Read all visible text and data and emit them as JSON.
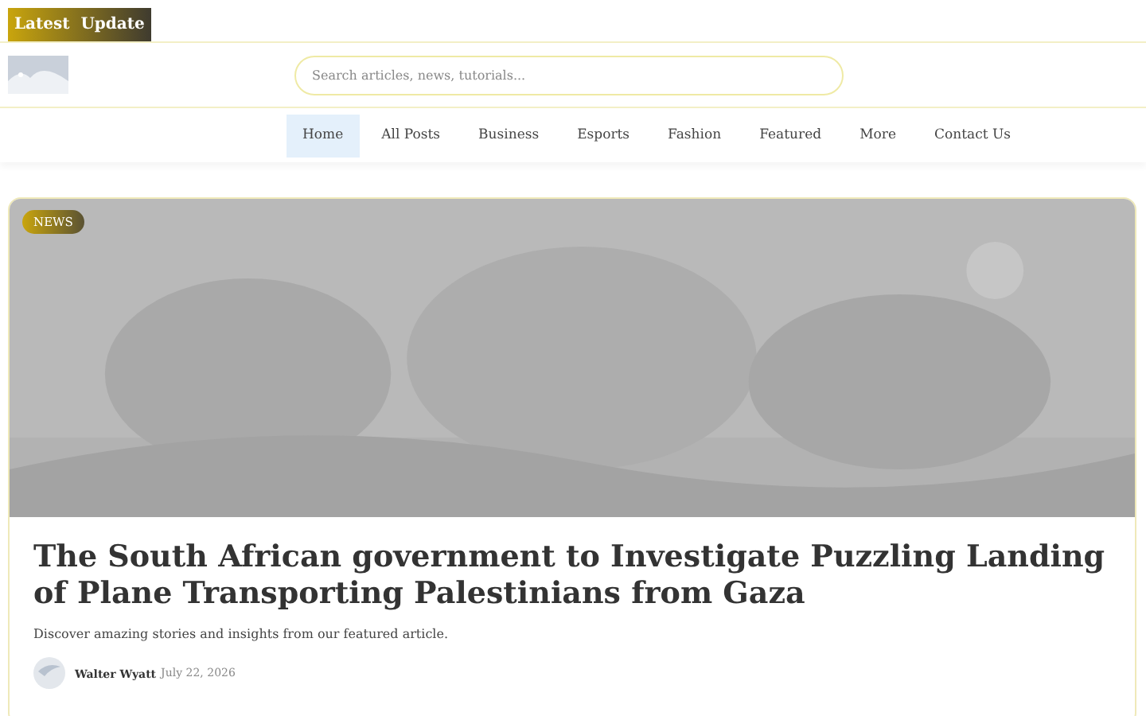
{
  "top_badge": "Latest  Update",
  "search": {
    "placeholder": "Search articles, news, tutorials..."
  },
  "nav": [
    {
      "label": "Home",
      "selected": true
    },
    {
      "label": "All Posts",
      "selected": false
    },
    {
      "label": "Business",
      "selected": false
    },
    {
      "label": "Esports",
      "selected": false
    },
    {
      "label": "Fashion",
      "selected": false
    },
    {
      "label": "Featured",
      "selected": false
    },
    {
      "label": "More",
      "selected": false
    },
    {
      "label": "Contact Us",
      "selected": false
    }
  ],
  "featured": {
    "category": "NEWS",
    "title": "The South African government to Investigate Puzzling Landing of Plane Transporting Palestinians from Gaza",
    "excerpt": "Discover amazing stories and insights from our featured article.",
    "author": "Walter Wyatt",
    "date": "July 22, 2026"
  }
}
